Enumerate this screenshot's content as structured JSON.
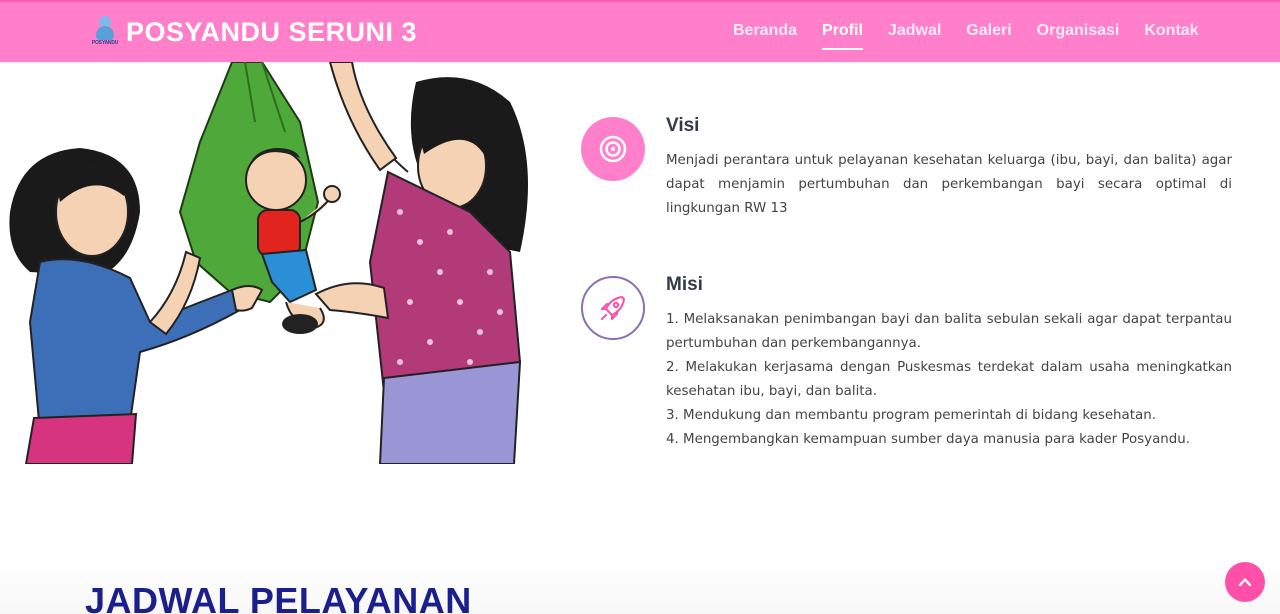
{
  "header": {
    "logo_text": "POSYANDU",
    "brand_title": "POSYANDU SERUNI 3",
    "nav": [
      {
        "label": "Beranda",
        "active": false
      },
      {
        "label": "Profil",
        "active": true
      },
      {
        "label": "Jadwal",
        "active": false
      },
      {
        "label": "Galeri",
        "active": false
      },
      {
        "label": "Organisasi",
        "active": false
      },
      {
        "label": "Kontak",
        "active": false
      }
    ]
  },
  "visi": {
    "icon": "target-icon",
    "title": "Visi",
    "text": "Menjadi perantara untuk pelayanan kesehatan keluarga (ibu, bayi, dan balita) agar dapat menjamin pertumbuhan dan perkembangan bayi secara optimal di lingkungan RW 13"
  },
  "misi": {
    "icon": "rocket-icon",
    "title": "Misi",
    "items": [
      "1. Melaksanakan penimbangan bayi dan balita sebulan sekali agar dapat terpantau pertumbuhan dan perkembangannya.",
      "2. Melakukan kerjasama dengan Puskesmas terdekat dalam usaha meningkatkan kesehatan ibu, bayi, dan balita.",
      "3. Mendukung dan membantu program pemerintah di bidang kesehatan.",
      "4. Mengembangkan kemampuan sumber daya manusia para kader Posyandu."
    ]
  },
  "section": {
    "title": "JADWAL PELAYANAN"
  },
  "colors": {
    "header": "#ff7fcb",
    "accent": "#ff4fa8",
    "heading": "#1a1f8c",
    "mission_icon": "#8a6fb3"
  }
}
